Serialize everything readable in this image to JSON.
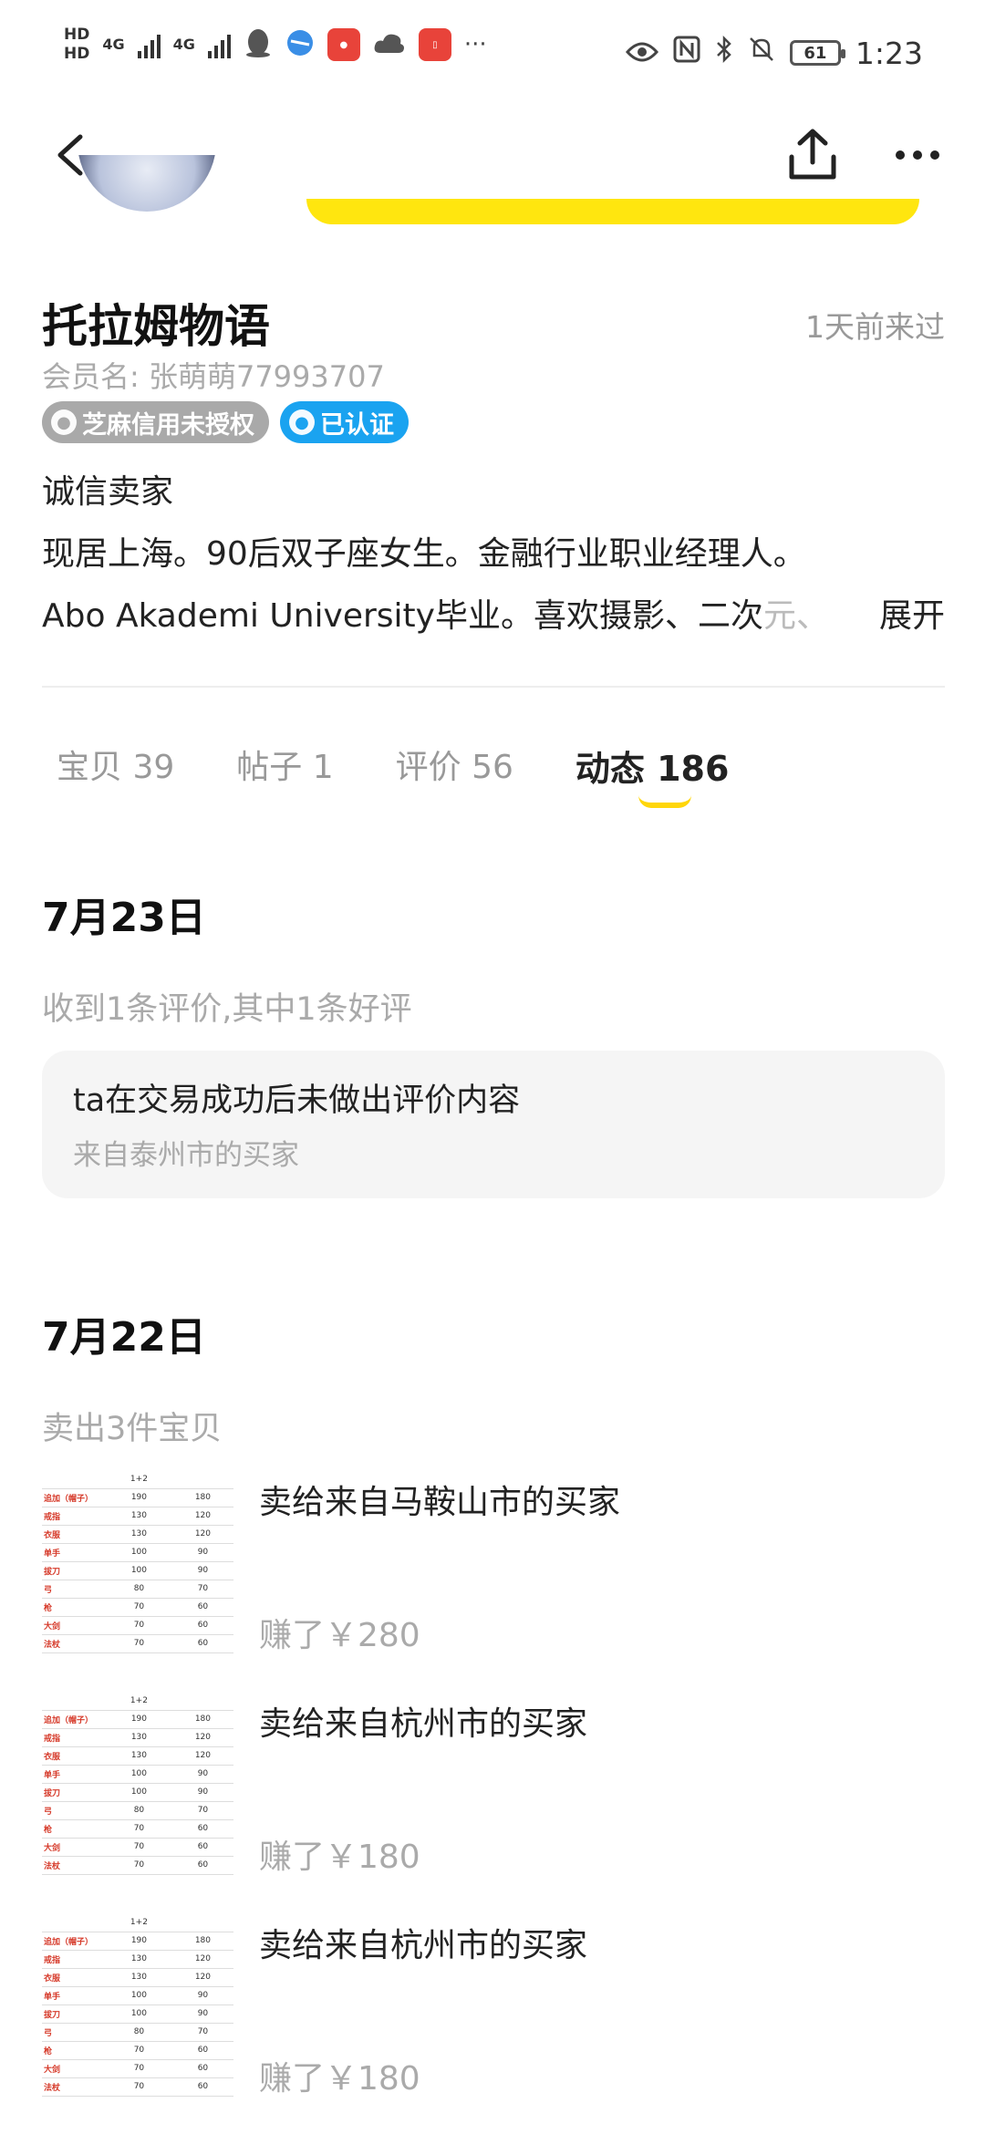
{
  "status_bar": {
    "hd1": "HD",
    "hd2": "HD",
    "net1": "4G",
    "net2": "4G",
    "battery": "61",
    "time": "1:23",
    "icons": [
      "qq-icon",
      "browser-icon",
      "huawei-icon",
      "cloud-icon",
      "book-icon",
      "more-dots-icon",
      "eye-icon",
      "nfc-icon",
      "bluetooth-icon",
      "mute-icon"
    ]
  },
  "profile": {
    "name": "托拉姆物语",
    "last_seen": "1天前来过",
    "member_id": "会员名: 张萌萌77993707",
    "badge_credit": "芝麻信用未授权",
    "badge_verified": "已认证",
    "bio_line1": "诚信卖家",
    "bio_line2": "现居上海。90后双子座女生。金融行业职业经理人。",
    "bio_line3": "Abo Akademi University毕业。喜欢摄影、二次",
    "bio_line3_fade": "元、",
    "expand": "展开"
  },
  "tabs": [
    {
      "label": "宝贝 39"
    },
    {
      "label": "帖子 1"
    },
    {
      "label": "评价 56"
    },
    {
      "label": "动态 186"
    }
  ],
  "feed": {
    "day1": {
      "date": "7月23日",
      "summary": "收到1条评价,其中1条好评",
      "review_text": "ta在交易成功后未做出评价内容",
      "review_from": "来自泰州市的买家"
    },
    "day2": {
      "date": "7月22日",
      "summary": "卖出3件宝贝",
      "sales": [
        {
          "title": "卖给来自马鞍山市的买家",
          "earn": "赚了￥280"
        },
        {
          "title": "卖给来自杭州市的买家",
          "earn": "赚了￥180"
        },
        {
          "title": "卖给来自杭州市的买家",
          "earn": "赚了￥180"
        }
      ]
    }
  },
  "thumb_table": {
    "header": [
      "",
      "1+2",
      ""
    ],
    "rows": [
      [
        "追加（帽子）",
        "190",
        "180"
      ],
      [
        "戒指",
        "130",
        "120"
      ],
      [
        "衣服",
        "130",
        "120"
      ],
      [
        "单手",
        "100",
        "90"
      ],
      [
        "拔刀",
        "100",
        "90"
      ],
      [
        "弓",
        "80",
        "70"
      ],
      [
        "枪",
        "70",
        "60"
      ],
      [
        "大剑",
        "70",
        "60"
      ],
      [
        "法杖",
        "70",
        "60"
      ]
    ]
  },
  "colors": {
    "accent_yellow": "#ffe60f",
    "verified_blue": "#1aa3f0",
    "credit_grey": "#a9a9a9"
  }
}
